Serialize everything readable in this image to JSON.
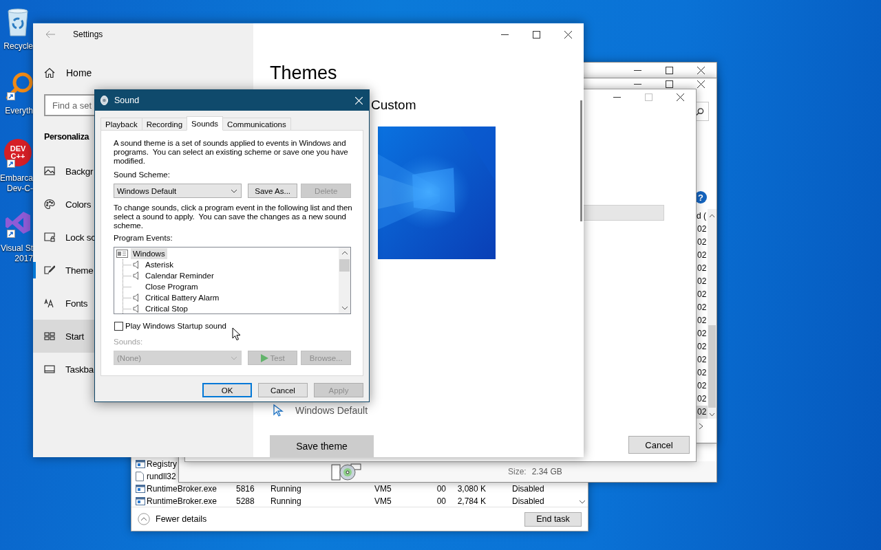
{
  "desktop_icons": [
    {
      "kind": "recycle_bin",
      "lines": [
        "Recycle"
      ],
      "shortcut": false
    },
    {
      "kind": "magnifier",
      "lines": [
        "Everyth"
      ],
      "shortcut": true
    },
    {
      "kind": "dev_badge",
      "badge": [
        "DEV",
        "C++"
      ],
      "lines": [
        "Embarca",
        "Dev-C-"
      ],
      "shortcut": true
    },
    {
      "kind": "vs_logo",
      "lines": [
        "Visual St",
        "2017"
      ],
      "shortcut": true
    }
  ],
  "task_manager": {
    "rows": [
      {
        "kind": "app",
        "cells": [
          "Registry"
        ]
      },
      {
        "kind": "file",
        "cells": [
          "rundll32"
        ]
      },
      {
        "kind": "app",
        "cells": [
          "RuntimeBroker.exe",
          "5816",
          "Running",
          "VM5",
          "00",
          "3,080 K",
          "Disabled"
        ]
      },
      {
        "kind": "app",
        "cells": [
          "RuntimeBroker.exe",
          "5288",
          "Running",
          "VM5",
          "00",
          "2,784 K",
          "Disabled"
        ]
      }
    ],
    "fewer_details": "Fewer details",
    "end_task": "End task"
  },
  "disk_window": {
    "size_label": "Size:",
    "size_value": "2.34 GB"
  },
  "list_window": {
    "help": "?",
    "column_header": "d (",
    "rows": [
      {
        "text": "02",
        "selected": false
      },
      {
        "text": "02",
        "selected": false
      },
      {
        "text": "02",
        "selected": false
      },
      {
        "text": "02",
        "selected": false
      },
      {
        "text": "02",
        "selected": false
      },
      {
        "text": "02",
        "selected": false
      },
      {
        "text": "02",
        "selected": false
      },
      {
        "text": "02",
        "selected": false
      },
      {
        "text": "02",
        "selected": false
      },
      {
        "text": "02",
        "selected": false
      },
      {
        "text": "02",
        "selected": false
      },
      {
        "text": "02",
        "selected": false
      },
      {
        "text": "02",
        "selected": false
      },
      {
        "text": "02",
        "selected": false
      },
      {
        "text": "02",
        "selected": true
      }
    ]
  },
  "setup_window": {
    "maximize_disabled": true,
    "cancel": "Cancel"
  },
  "settings": {
    "title": "Settings",
    "home": "Home",
    "search_placeholder": "Find a set",
    "section": "Personaliza",
    "nav": [
      {
        "kind": "background",
        "label": "Backgr",
        "selected": false,
        "hovered": false
      },
      {
        "kind": "colors",
        "label": "Colors",
        "selected": false,
        "hovered": false
      },
      {
        "kind": "lock_screen",
        "label": "Lock sc",
        "selected": false,
        "hovered": false
      },
      {
        "kind": "themes",
        "label": "Theme",
        "selected": true,
        "hovered": false
      },
      {
        "kind": "fonts",
        "label": "Fonts",
        "selected": false,
        "hovered": false
      },
      {
        "kind": "start",
        "label": "Start",
        "selected": false,
        "hovered": true
      },
      {
        "kind": "taskbar",
        "label": "Taskba",
        "selected": false,
        "hovered": false
      }
    ],
    "page_title": "Themes",
    "current_theme": "Custom",
    "cursor_label": "Windows Default",
    "save_theme": "Save theme"
  },
  "sound": {
    "title": "Sound",
    "tabs": [
      {
        "label": "Playback",
        "selected": false
      },
      {
        "label": "Recording",
        "selected": false
      },
      {
        "label": "Sounds",
        "selected": true
      },
      {
        "label": "Communications",
        "selected": false
      }
    ],
    "intro": "A sound theme is a set of sounds applied to events in Windows and programs.  You can select an existing scheme or save one you have modified.",
    "scheme_label": "Sound Scheme:",
    "scheme": "Windows Default",
    "save_as": {
      "label": "Save As...",
      "disabled": false
    },
    "delete": {
      "label": "Delete",
      "disabled": true
    },
    "instructions": "To change sounds, click a program event in the following list and then select a sound to apply.  You can save the changes as a new sound scheme.",
    "events_label": "Program Events:",
    "events": [
      {
        "label": "Windows",
        "selected": true,
        "children": [
          {
            "label": "Asterisk",
            "has_sound": true,
            "selected": false
          },
          {
            "label": "Calendar Reminder",
            "has_sound": true,
            "selected": false
          },
          {
            "label": "Close Program",
            "has_sound": false,
            "selected": false
          },
          {
            "label": "Critical Battery Alarm",
            "has_sound": true,
            "selected": false
          },
          {
            "label": "Critical Stop",
            "has_sound": true,
            "selected": false
          }
        ]
      }
    ],
    "startup": {
      "label": "Play Windows Startup sound",
      "checked": false
    },
    "sounds_label": "Sounds:",
    "sound_value": "(None)",
    "sound_disabled": true,
    "test": {
      "label": "Test",
      "disabled": true
    },
    "browse": {
      "label": "Browse...",
      "disabled": true
    },
    "buttons": [
      {
        "label": "OK",
        "kind": "default",
        "disabled": false
      },
      {
        "label": "Cancel",
        "kind": "normal",
        "disabled": false
      },
      {
        "label": "Apply",
        "kind": "normal",
        "disabled": true
      }
    ]
  }
}
